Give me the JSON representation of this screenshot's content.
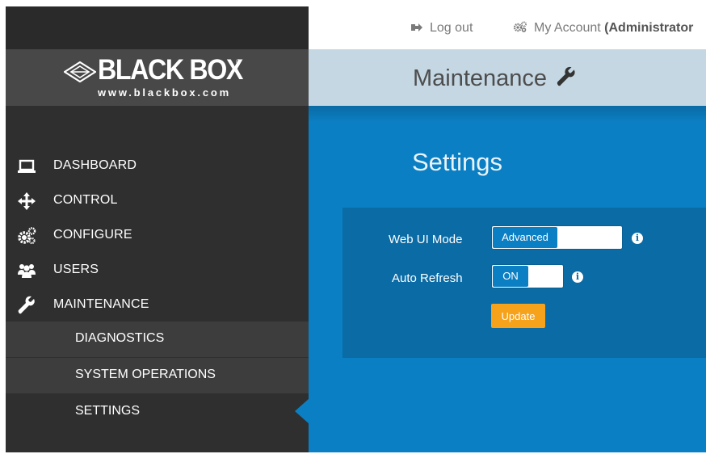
{
  "topbar": {
    "logout_label": "Log out",
    "account_label": "My Account",
    "account_role": "(Administrator"
  },
  "brand": {
    "name": "BLACK BOX",
    "url": "www.blackbox.com",
    "reg_mark": "®"
  },
  "nav": {
    "items": [
      {
        "label": "DASHBOARD",
        "icon": "laptop-icon"
      },
      {
        "label": "CONTROL",
        "icon": "move-arrows-icon"
      },
      {
        "label": "CONFIGURE",
        "icon": "gears-icon"
      },
      {
        "label": "USERS",
        "icon": "users-icon"
      },
      {
        "label": "MAINTENANCE",
        "icon": "wrench-icon"
      }
    ],
    "sub_items": [
      {
        "label": "DIAGNOSTICS"
      },
      {
        "label": "SYSTEM OPERATIONS"
      },
      {
        "label": "SETTINGS",
        "active": true
      }
    ]
  },
  "header": {
    "title": "Maintenance",
    "title_icon": "wrench-icon"
  },
  "settings": {
    "title": "Settings",
    "web_ui_mode": {
      "label": "Web UI Mode",
      "value": "Advanced"
    },
    "auto_refresh": {
      "label": "Auto Refresh",
      "value": "ON"
    },
    "info_glyph": "i",
    "update_label": "Update"
  },
  "colors": {
    "sidebar": "#2f2f2f",
    "header": "#c4d7e3",
    "main": "#0b7fc3",
    "panel": "#0a6ba5",
    "accent_button": "#f7a21b"
  }
}
